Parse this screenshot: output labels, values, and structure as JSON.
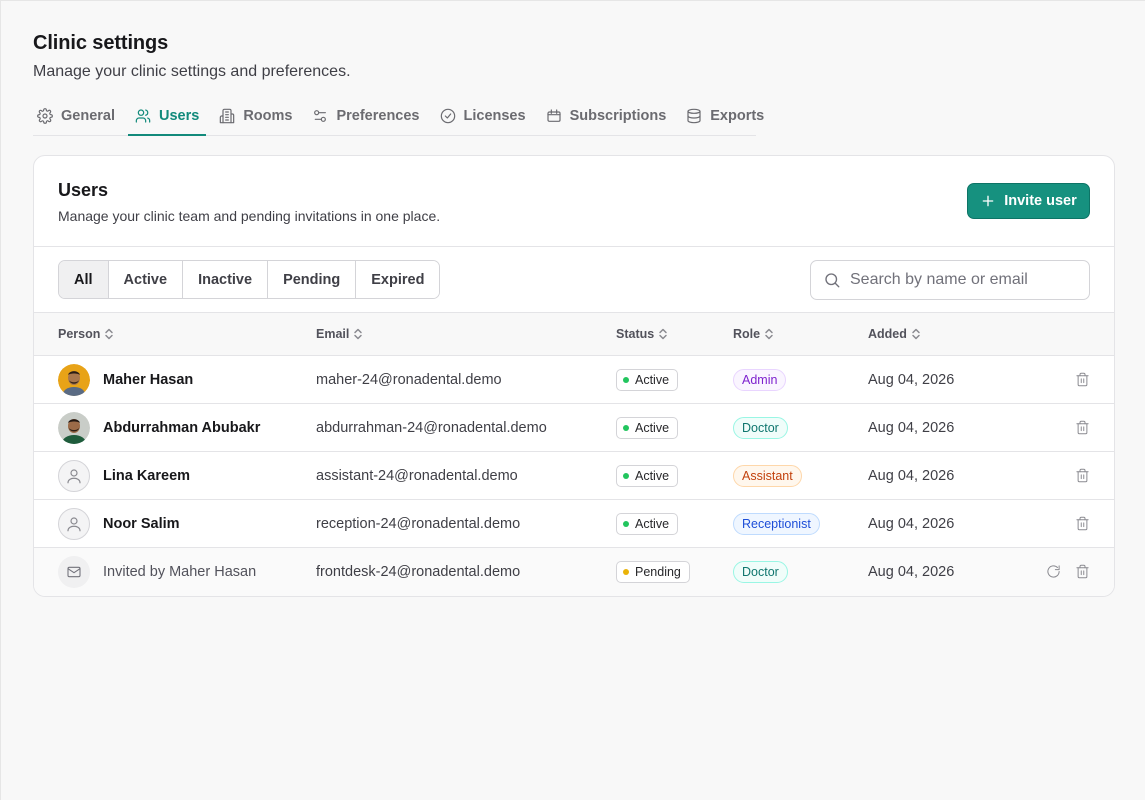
{
  "header": {
    "title": "Clinic settings",
    "subtitle": "Manage your clinic settings and preferences."
  },
  "tabs": [
    {
      "label": "General",
      "icon": "gear-icon"
    },
    {
      "label": "Users",
      "icon": "users-icon",
      "active": true
    },
    {
      "label": "Rooms",
      "icon": "building-icon"
    },
    {
      "label": "Preferences",
      "icon": "sliders-icon"
    },
    {
      "label": "Licenses",
      "icon": "check-circle-icon"
    },
    {
      "label": "Subscriptions",
      "icon": "ticket-icon"
    },
    {
      "label": "Exports",
      "icon": "database-icon"
    }
  ],
  "users_card": {
    "title": "Users",
    "subtitle": "Manage your clinic team and pending invitations in one place.",
    "invite_label": "Invite user"
  },
  "filters": [
    "All",
    "Active",
    "Inactive",
    "Pending",
    "Expired"
  ],
  "active_filter": "All",
  "search": {
    "placeholder": "Search by name or email",
    "value": ""
  },
  "columns": [
    "Person",
    "Email",
    "Status",
    "Role",
    "Added"
  ],
  "rows": [
    {
      "name": "Maher Hasan",
      "email": "maher-24@ronadental.demo",
      "status": "Active",
      "role": "Admin",
      "added": "Aug 04, 2026",
      "avatar": "photo-orange"
    },
    {
      "name": "Abdurrahman Abubakr",
      "email": "abdurrahman-24@ronadental.demo",
      "status": "Active",
      "role": "Doctor",
      "added": "Aug 04, 2026",
      "avatar": "photo-green"
    },
    {
      "name": "Lina Kareem",
      "email": "assistant-24@ronadental.demo",
      "status": "Active",
      "role": "Assistant",
      "added": "Aug 04, 2026",
      "avatar": "user-icon"
    },
    {
      "name": "Noor Salim",
      "email": "reception-24@ronadental.demo",
      "status": "Active",
      "role": "Receptionist",
      "added": "Aug 04, 2026",
      "avatar": "user-icon"
    },
    {
      "name": "Invited by Maher Hasan",
      "email": "frontdesk-24@ronadental.demo",
      "status": "Pending",
      "role": "Doctor",
      "added": "Aug 04, 2026",
      "avatar": "mail-icon",
      "pending": true
    }
  ],
  "colors": {
    "accent": "#16917f",
    "status_active": "#22c55e",
    "status_pending": "#eab308",
    "role_admin": "#7e22ce",
    "role_doctor": "#0f766e",
    "role_assistant": "#c2410c",
    "role_receptionist": "#1d4ed8"
  }
}
